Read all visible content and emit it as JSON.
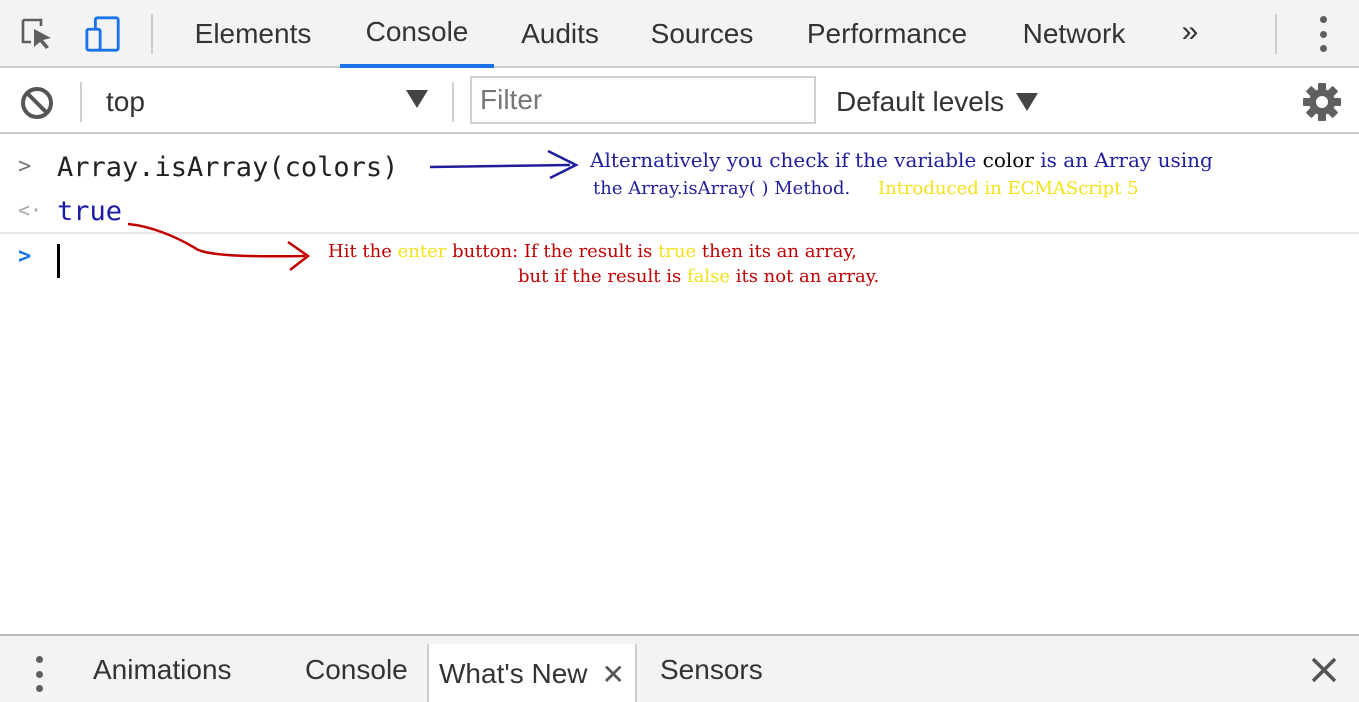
{
  "toolbar_tabs": {
    "inspect_icon": "inspect-element-icon",
    "device_icon": "device-toolbar-icon",
    "tabs": [
      "Elements",
      "Console",
      "Audits",
      "Sources",
      "Performance",
      "Network"
    ],
    "active_tab": "Console",
    "more_tabs_glyph": "»",
    "menu_icon": "kebab-menu-icon"
  },
  "console_toolbar": {
    "clear_icon": "clear-console-icon",
    "context_value": "top",
    "filter_placeholder": "Filter",
    "levels_label": "Default levels",
    "settings_icon": "gear-icon"
  },
  "console": {
    "input_prompt": ">",
    "input_code": "Array.isArray(colors)",
    "result_prompt": "<·",
    "result_value": "true",
    "active_prompt": ">"
  },
  "annotations": {
    "blue_line1_a": "Alternatively you check if the variable ",
    "blue_line1_b": "color",
    "blue_line1_c": " is an Array using",
    "blue_line2": "the Array.isArray( ) Method.",
    "blue_line2_yellow": "Introduced in ECMAScript 5",
    "red_line1_a": "Hit the ",
    "red_line1_b": "enter",
    "red_line1_c": " button: If the result is ",
    "red_line1_d": "true",
    "red_line1_e": " then its an array,",
    "red_line2_a": "but if the result is ",
    "red_line2_b": "false",
    "red_line2_c": " its not an array."
  },
  "drawer": {
    "menu_icon": "kebab-menu-icon",
    "tabs": [
      "Animations",
      "Console",
      "What's New",
      "Sensors"
    ],
    "active_tab": "What's New",
    "tab_close_glyph": "✕",
    "close_glyph": "✕"
  },
  "colors": {
    "accent": "#1a73e8",
    "annotation_blue": "#1f1f9c",
    "annotation_red": "#c00000",
    "annotation_yellow": "#f2e21a",
    "result_blue": "#1a1aa6"
  }
}
